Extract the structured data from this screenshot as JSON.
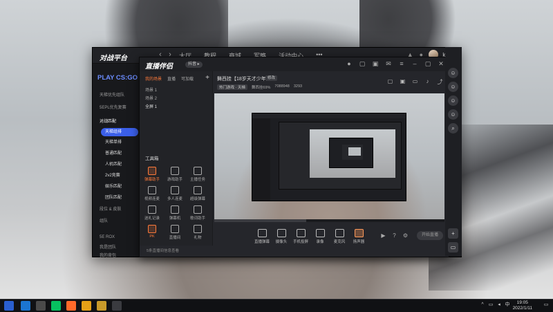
{
  "main_app": {
    "logo": "对战平台",
    "nav": [
      "大厅",
      "教程",
      "商城",
      "军略",
      "活动中心",
      "•••"
    ],
    "username": "kaitlu",
    "left_panel": {
      "title": "PLAY CS:GO",
      "items": [
        "天梯优先组队",
        "5EPL优先复赛",
        "对战匹配"
      ],
      "modes": [
        "天梯组排",
        "天梯单排",
        "普通匹配",
        "人机匹配",
        "2v2竞赛",
        "娱乐匹配",
        "团队匹配"
      ],
      "bottom_items": [
        "段位 & 皮肤",
        "组队",
        "5E ROX",
        "我是团队",
        "我的背包"
      ]
    }
  },
  "stream_app": {
    "logo": "直播伴侣",
    "badge": "抖音 ▸",
    "tabs": [
      "我的场景",
      "直播",
      "可加载"
    ],
    "scenes": [
      "场景 1",
      "场景 2",
      "全屏 1"
    ],
    "tools_label": "工具箱",
    "tools": [
      "弹幕助手",
      "游戏助手",
      "主播任务",
      "视频连麦",
      "多人连麦",
      "超级弹幕",
      "送礼记录",
      "弹幕机",
      "歌词助手",
      "PK",
      "直播间",
      "礼物"
    ],
    "footer": "5条直播间信息查看",
    "room_title": "舞西挂【18岁天才少年】",
    "room_edit": "修改",
    "room_meta": [
      "热门游戏 · 天梯",
      "舞西挂69%",
      "7088948",
      "3293"
    ],
    "bottom_tools": [
      "直播弹幕",
      "摄像头",
      "手机投屏",
      "录像",
      "麦克风",
      "扬声器"
    ],
    "start_label": "开始直播"
  },
  "taskbar": {
    "time": "19:05",
    "date": "2022/1/11"
  }
}
